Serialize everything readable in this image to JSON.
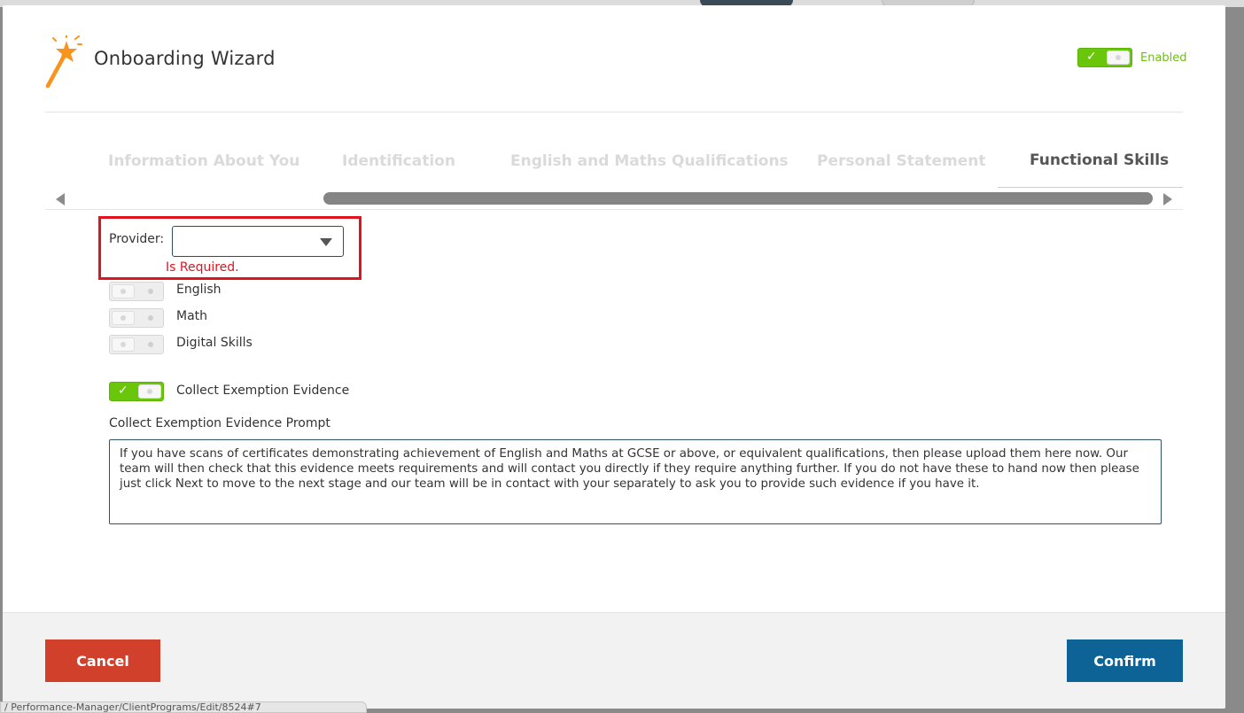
{
  "modal": {
    "title": "Onboarding Wizard",
    "enabled_label": "Enabled",
    "enabled": true
  },
  "tabs": [
    {
      "label": "Information About You",
      "active": false
    },
    {
      "label": "Identification",
      "active": false
    },
    {
      "label": "English and Maths Qualifications",
      "active": false
    },
    {
      "label": "Personal Statement",
      "active": false
    },
    {
      "label": "Functional Skills",
      "active": true
    }
  ],
  "provider": {
    "label": "Provider:",
    "value": "",
    "error": "Is Required."
  },
  "skills": [
    {
      "label": "English",
      "enabled": false
    },
    {
      "label": "Math",
      "enabled": false
    },
    {
      "label": "Digital Skills",
      "enabled": false
    }
  ],
  "exemption": {
    "label": "Collect Exemption Evidence",
    "enabled": true,
    "prompt_label": "Collect Exemption Evidence Prompt",
    "prompt_text": "If you have scans of certificates demonstrating achievement of English and Maths at GCSE or above, or equivalent qualifications, then please upload them here now. Our team will then check that this evidence meets requirements and will contact you directly if they require anything further. If you do not have these to hand now then please just click Next to move to the next stage and our team will be in contact with your separately to ask you to provide such evidence if you have it."
  },
  "footer": {
    "cancel_label": "Cancel",
    "confirm_label": "Confirm"
  },
  "status_bar": {
    "url": "/ Performance-Manager/ClientPrograms/Edit/8524#7"
  },
  "colors": {
    "toggle_on": "#69c60a",
    "error": "#e0141e",
    "cancel": "#d0402a",
    "confirm": "#0d6396",
    "wand": "#f7941d"
  },
  "icons": {
    "title_icon": "magic-wand-icon"
  }
}
